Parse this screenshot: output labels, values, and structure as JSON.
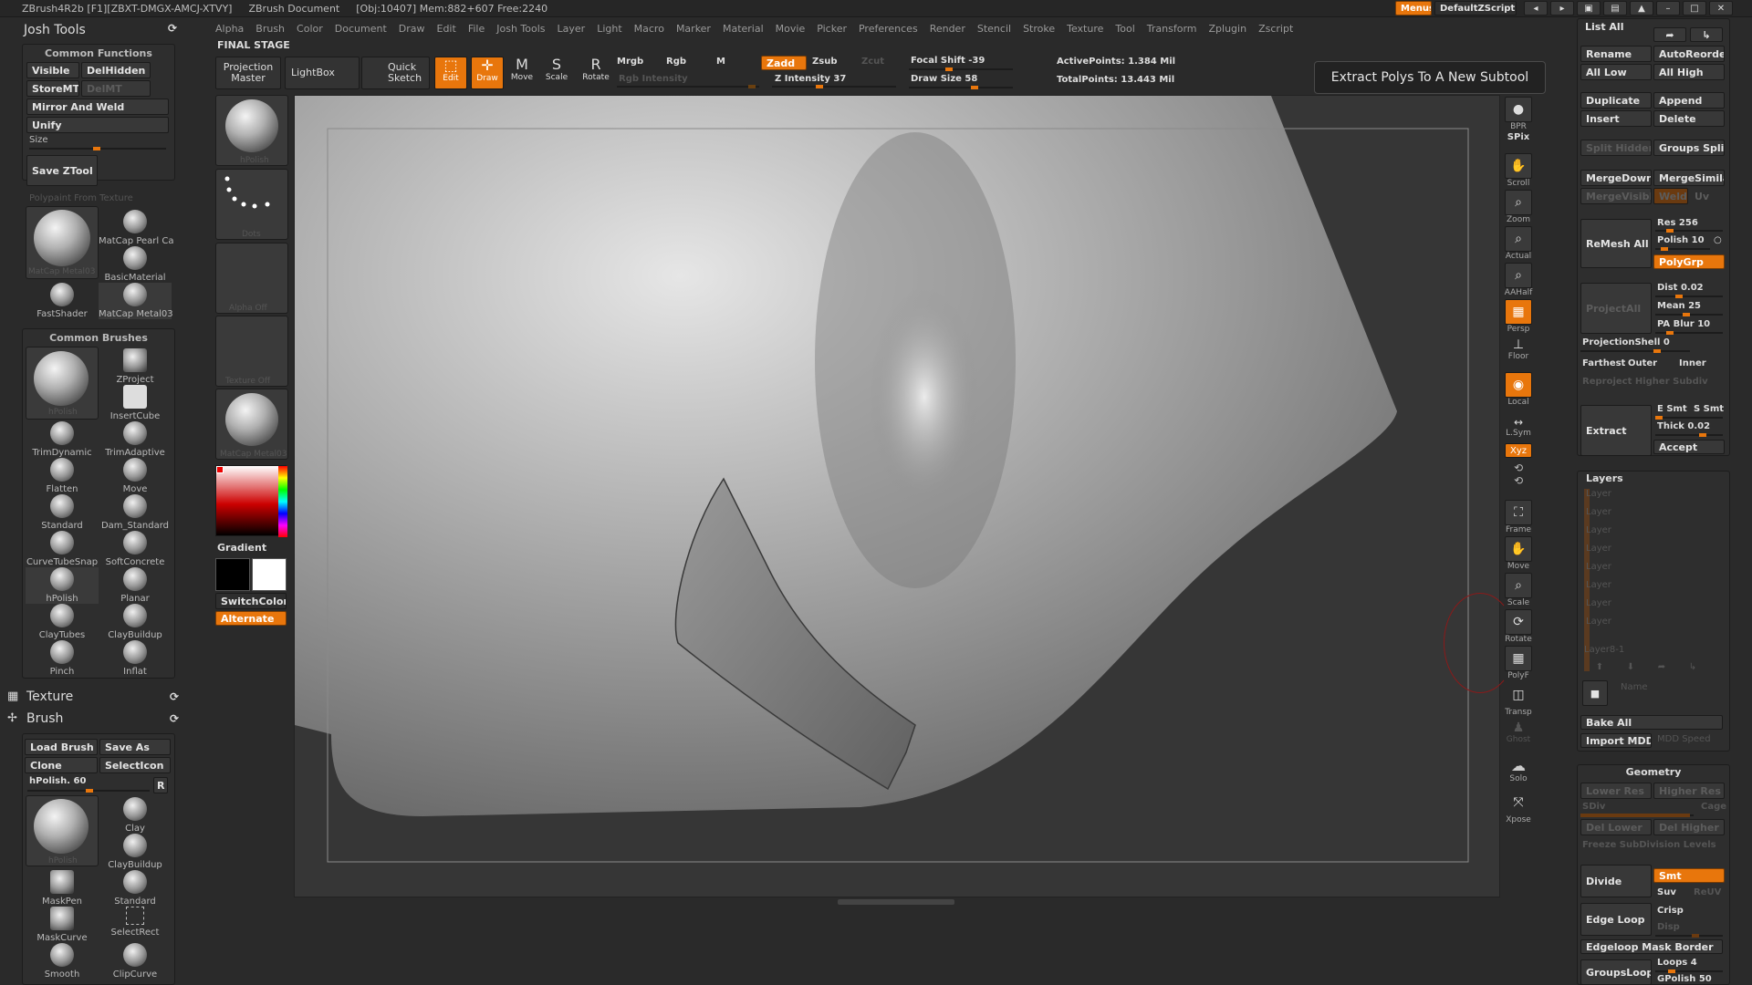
{
  "titlebar": {
    "app": "ZBrush4R2b [F1][ZBXT-DMGX-AMCJ-XTVY]",
    "doc": "ZBrush Document",
    "mem": "[Obj:10407] Mem:882+607 Free:2240",
    "menus_btn": "Menus",
    "zscript": "DefaultZScript"
  },
  "menubar": [
    "Alpha",
    "Brush",
    "Color",
    "Document",
    "Draw",
    "Edit",
    "File",
    "Josh Tools",
    "Layer",
    "Light",
    "Macro",
    "Marker",
    "Material",
    "Movie",
    "Picker",
    "Preferences",
    "Render",
    "Stencil",
    "Stroke",
    "Texture",
    "Tool",
    "Transform",
    "Zplugin",
    "Zscript"
  ],
  "left": {
    "josh_title": "Josh Tools",
    "common_functions": "Common Functions",
    "visible": "Visible",
    "delhidden": "DelHidden",
    "storemt": "StoreMT",
    "delmt": "DelMT",
    "mirror": "Mirror And Weld",
    "unify": "Unify",
    "size": "Size",
    "save_ztool": "Save ZTool",
    "polypaint": "Polypaint From Texture",
    "materials": [
      "MatCap Metal03",
      "MatCap Pearl Ca",
      "BasicMaterial",
      "FastShader",
      "MatCap Metal03"
    ],
    "common_brushes": "Common Brushes",
    "brushes": [
      "hPolish",
      "ZProject",
      "InsertCube",
      "TrimDynamic",
      "TrimAdaptive",
      "Flatten",
      "Move",
      "Standard",
      "Dam_Standard",
      "CurveTubeSnap",
      "SoftConcrete",
      "hPolish",
      "Planar",
      "ClayTubes",
      "ClayBuildup",
      "Pinch",
      "Inflat"
    ],
    "texture": "Texture",
    "brush": "Brush",
    "load_brush": "Load Brush",
    "save_as": "Save As",
    "clone": "Clone",
    "selecticon": "SelectIcon",
    "hpolish_slider": "hPolish. 60",
    "r": "R",
    "brush2": [
      "hPolish",
      "Clay",
      "ClayBuildup",
      "MaskPen",
      "Standard",
      "MaskCurve",
      "SelectRect",
      "Smooth",
      "ClipCurve"
    ]
  },
  "toolbar": {
    "final_stage": "FINAL STAGE",
    "projection_master": "Projection Master",
    "lightbox": "LightBox",
    "quick_sketch": "Quick Sketch",
    "edit": "Edit",
    "draw": "Draw",
    "move": "Move",
    "scale": "Scale",
    "rotate": "Rotate",
    "mrgb": "Mrgb",
    "rgb": "Rgb",
    "m": "M",
    "zadd": "Zadd",
    "zsub": "Zsub",
    "zcut": "Zcut",
    "rgb_intensity": "Rgb Intensity",
    "z_intensity": "Z Intensity 37",
    "focal_shift": "Focal Shift -39",
    "draw_size": "Draw Size 58",
    "active_points": "ActivePoints: 1.384 Mil",
    "total_points": "TotalPoints: 13.443 Mil",
    "tooltip": "Extract Polys To A New Subtool"
  },
  "shelf": {
    "hpolish": "hPolish",
    "dots": "Dots",
    "alpha": "Alpha Off",
    "texture": "Texture Off",
    "material": "MatCap Metal03",
    "gradient": "Gradient",
    "switchcolor": "SwitchColor",
    "alternate": "Alternate"
  },
  "rightbar": [
    "BPR",
    "SPix",
    "Scroll",
    "Zoom",
    "Actual",
    "AAHalf",
    "Persp",
    "Floor",
    "Local",
    "L.Sym",
    "Xyz",
    "Frame",
    "Move",
    "Scale",
    "Rotate",
    "PolyF",
    "Transp",
    "Ghost",
    "Solo",
    "Xpose"
  ],
  "subtool": {
    "list_all": "List All",
    "rename": "Rename",
    "autoreorder": "AutoReorder",
    "all_low": "All Low",
    "all_high": "All High",
    "duplicate": "Duplicate",
    "append": "Append",
    "insert": "Insert",
    "delete": "Delete",
    "split_hidden": "Split Hidden",
    "groups_split": "Groups Split",
    "mergedown": "MergeDown",
    "mergesimilar": "MergeSimilar",
    "mergevisible": "MergeVisible",
    "weld": "Weld",
    "uv": "Uv",
    "remesh_all": "ReMesh All",
    "res": "Res 256",
    "polish": "Polish 10",
    "polygrp": "PolyGrp",
    "projectall": "ProjectAll",
    "dist": "Dist 0.02",
    "mean": "Mean 25",
    "pa_blur": "PA Blur 10",
    "projshell": "ProjectionShell 0",
    "farthest": "Farthest",
    "outer": "Outer",
    "inner": "Inner",
    "reproject": "Reproject Higher Subdiv",
    "extract": "Extract",
    "esmt": "E Smt",
    "ssmt": "S Smt",
    "thick": "Thick 0.02",
    "accept": "Accept"
  },
  "layers": {
    "title": "Layers",
    "items": [
      "Layer",
      "Layer",
      "Layer",
      "Layer",
      "Layer",
      "Layer",
      "Layer",
      "Layer"
    ],
    "layer_name": "Layer8-1",
    "name": "Name",
    "bake_all": "Bake All",
    "import_mdd": "Import MDD",
    "mdd_speed": "MDD Speed"
  },
  "geometry": {
    "title": "Geometry",
    "lower_res": "Lower Res",
    "higher_res": "Higher Res",
    "sdiv": "SDiv",
    "cage": "Cage",
    "del_lower": "Del Lower",
    "del_higher": "Del Higher",
    "freeze": "Freeze SubDivision Levels",
    "divide": "Divide",
    "smt": "Smt",
    "suv": "Suv",
    "reuv": "ReUV",
    "edge_loop": "Edge Loop",
    "crisp": "Crisp",
    "disp": "Disp",
    "edgeloop_mask": "Edgeloop Mask Border",
    "groupsloops": "GroupsLoops",
    "loops": "Loops 4",
    "gpolish": "GPolish 50"
  },
  "colors": {
    "accent": "#e8760c",
    "panel": "#2e2e2e",
    "bg": "#2a2a2a"
  }
}
